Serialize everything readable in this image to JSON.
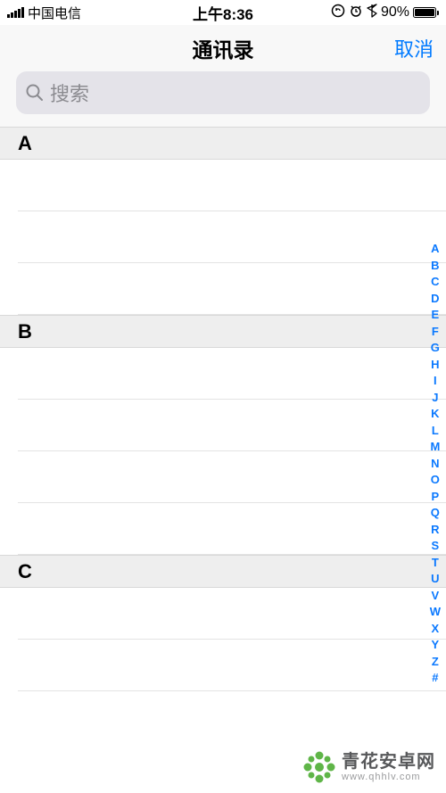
{
  "status": {
    "carrier": "中国电信",
    "time": "上午8:36",
    "battery_pct": "90%"
  },
  "nav": {
    "title": "通讯录",
    "cancel": "取消"
  },
  "search": {
    "placeholder": "搜索"
  },
  "sections": {
    "a": "A",
    "b": "B",
    "c": "C"
  },
  "index_bar": [
    "A",
    "B",
    "C",
    "D",
    "E",
    "F",
    "G",
    "H",
    "I",
    "J",
    "K",
    "L",
    "M",
    "N",
    "O",
    "P",
    "Q",
    "R",
    "S",
    "T",
    "U",
    "V",
    "W",
    "X",
    "Y",
    "Z",
    "#"
  ],
  "watermark": {
    "name": "青花安卓网",
    "url": "www.qhhlv.com"
  }
}
